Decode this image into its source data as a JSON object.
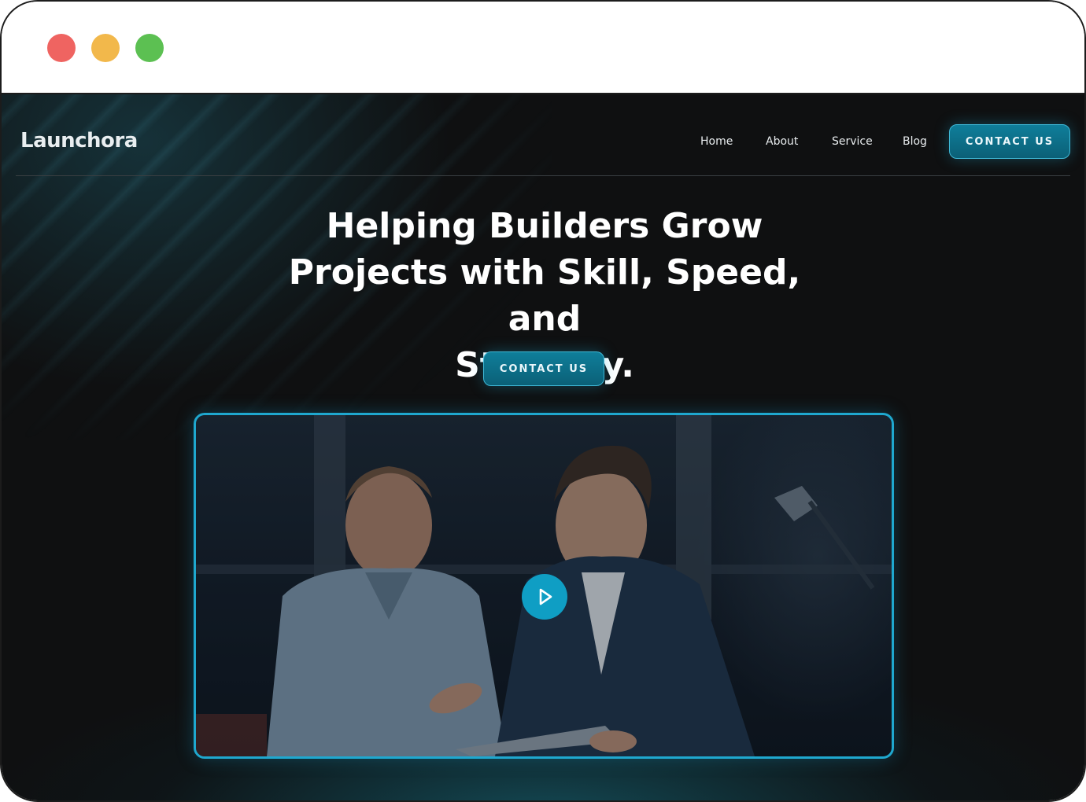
{
  "window": {
    "controls": [
      "close",
      "minimize",
      "maximize"
    ],
    "colors": {
      "close": "#ef6461",
      "minimize": "#f2b84b",
      "maximize": "#5cc052"
    }
  },
  "header": {
    "logo": "Launchora",
    "nav": [
      "Home",
      "About",
      "Service",
      "Blog"
    ],
    "cta_label": "CONTACT US"
  },
  "hero": {
    "headline_lines": [
      "Helping Builders Grow",
      "Projects with Skill, Speed, and",
      "Strategy."
    ],
    "cta_label": "CONTACT US"
  },
  "video": {
    "play_icon": "play-icon",
    "accent": "#1fa8cf"
  },
  "colors": {
    "background": "#0f1011",
    "accent": "#0f7e9a",
    "text": "#ffffff"
  }
}
